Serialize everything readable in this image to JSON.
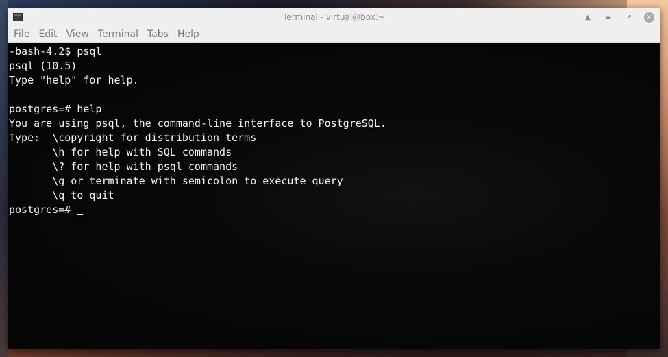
{
  "window": {
    "title": "Terminal - virtual@box:~"
  },
  "controls": {
    "shade_icon": "▲",
    "minimize_icon": "▬",
    "maximize_icon": "↗",
    "close_icon": "✕"
  },
  "menu": {
    "items": [
      "File",
      "Edit",
      "View",
      "Terminal",
      "Tabs",
      "Help"
    ]
  },
  "terminal": {
    "lines": [
      "-bash-4.2$ psql",
      "psql (10.5)",
      "Type \"help\" for help.",
      "",
      "postgres=# help",
      "You are using psql, the command-line interface to PostgreSQL.",
      "Type:  \\copyright for distribution terms",
      "       \\h for help with SQL commands",
      "       \\? for help with psql commands",
      "       \\g or terminate with semicolon to execute query",
      "       \\q to quit"
    ],
    "prompt": "postgres=# "
  }
}
